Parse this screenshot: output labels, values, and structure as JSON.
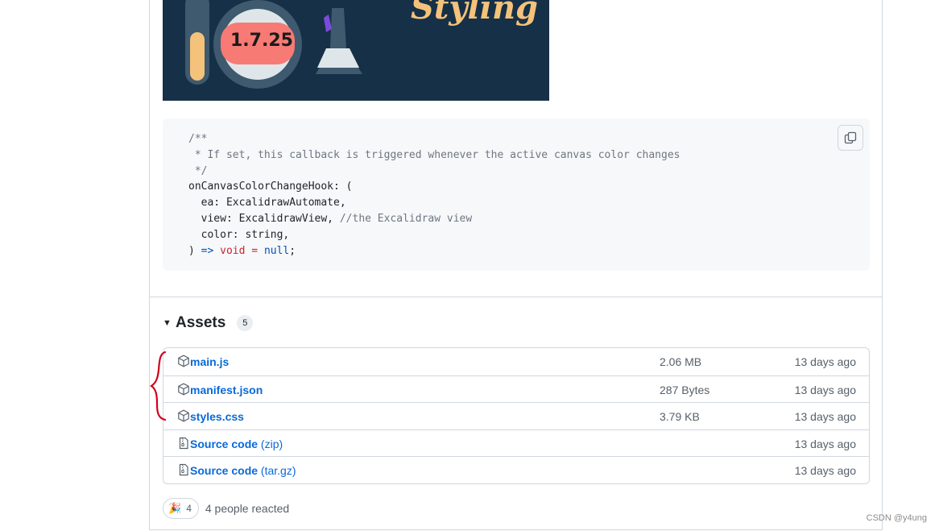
{
  "banner": {
    "text": "Styling",
    "version": "1.7.25"
  },
  "code": {
    "line1": "/**",
    "line2": " * If set, this callback is triggered whenever the active canvas color changes",
    "line3": " */",
    "line4": "onCanvasColorChangeHook: (",
    "line5": "  ea: ExcalidrawAutomate,",
    "line6a": "  view: ExcalidrawView, ",
    "line6b": "//the Excalidraw view",
    "line7": "  color: string,",
    "line8a": ") ",
    "line8b": "=>",
    "line8c": "void",
    "line8d": "=",
    "line8e": "null",
    "line8f": ";",
    "copy_icon": "copy-icon"
  },
  "assets": {
    "caret": "▼",
    "title": "Assets",
    "count": "5",
    "items": [
      {
        "name": "main.js",
        "suffix": "",
        "size": "2.06 MB",
        "time": "13 days ago",
        "icon": "package-icon"
      },
      {
        "name": "manifest.json",
        "suffix": "",
        "size": "287 Bytes",
        "time": "13 days ago",
        "icon": "package-icon"
      },
      {
        "name": "styles.css",
        "suffix": "",
        "size": "3.79 KB",
        "time": "13 days ago",
        "icon": "package-icon"
      },
      {
        "name": "Source code",
        "suffix": " (zip)",
        "size": "",
        "time": "13 days ago",
        "icon": "file-zip-icon"
      },
      {
        "name": "Source code",
        "suffix": " (tar.gz)",
        "size": "",
        "time": "13 days ago",
        "icon": "file-zip-icon"
      }
    ]
  },
  "reactions": {
    "emoji": "🎉",
    "count": "4",
    "text": "4 people reacted"
  },
  "watermark": "CSDN @y4ung",
  "colors": {
    "link": "#0969da",
    "annotation": "#d0021b",
    "banner_bg": "#163047"
  }
}
